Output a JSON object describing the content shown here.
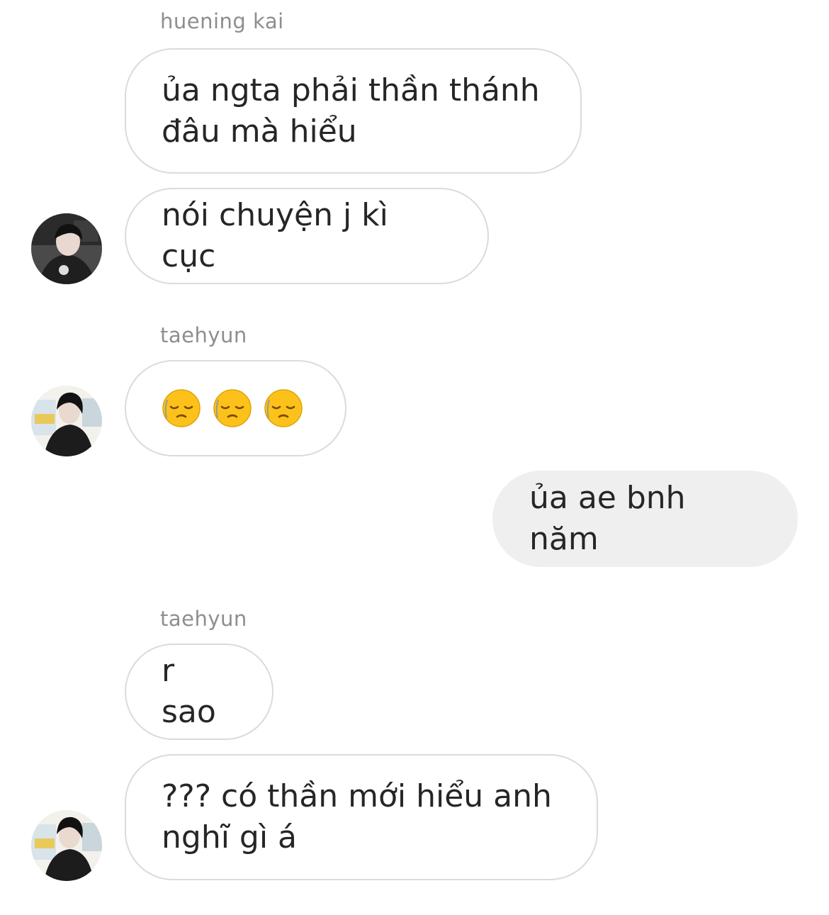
{
  "messages": [
    {
      "sender": "huening kai",
      "text": "ủa ngta phải thần thánh\nđâu mà hiểu"
    },
    {
      "text": "nói chuyện j kì cục"
    },
    {
      "sender": "taehyun",
      "emoji": [
        "pensive-face",
        "pensive-face",
        "pensive-face"
      ]
    },
    {
      "text": "ủa ae bnh năm"
    },
    {
      "sender": "taehyun",
      "text": "r sao"
    },
    {
      "text": "??? có thần mới hiểu anh\nnghĩ gì á"
    }
  ],
  "avatars": {
    "kai": "avatar-huening-kai",
    "taehyun": "avatar-taehyun"
  },
  "colors": {
    "incoming_bubble_bg": "#ffffff",
    "incoming_bubble_border": "#dbdbdb",
    "outgoing_bubble_bg": "#efefef",
    "sender_name": "#8e8e8e",
    "text": "#262626"
  }
}
